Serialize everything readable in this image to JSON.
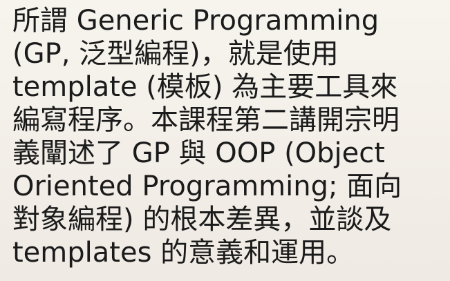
{
  "paragraph": {
    "lines": [
      "所謂 Generic Programming",
      "(GP, 泛型編程)，就是使用",
      "template (模板) 為主要工具來",
      "編寫程序。本課程第二講開宗明",
      "義闡述了 GP 與 OOP (Object",
      "Oriented Programming; 面向",
      "對象編程) 的根本差異，並談及",
      "templates 的意義和運用。"
    ]
  }
}
